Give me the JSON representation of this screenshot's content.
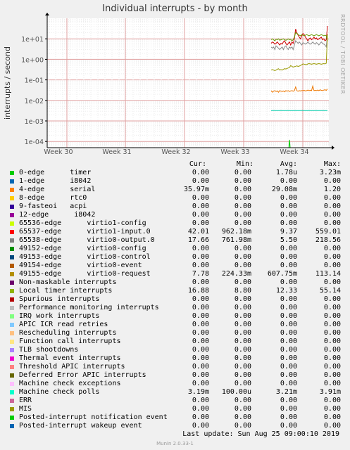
{
  "title": "Individual interrupts - by month",
  "side_label": "RRDTOOL / TOBI OETIKER",
  "footer": {
    "last_update": "Last update:  Sun Aug 25 09:00:10 2019",
    "munin": "Munin 2.0.33-1"
  },
  "chart_data": {
    "type": "line",
    "title": "Individual interrupts - by month",
    "ylabel": "interrupts / second",
    "yscale": "log",
    "ylim": [
      5e-05,
      100
    ],
    "yticks": [
      "1e+01",
      "1e+00",
      "1e-01",
      "1e-02",
      "1e-03",
      "1e-04"
    ],
    "x_ticks": [
      "Week 30",
      "Week 31",
      "Week 32",
      "Week 33",
      "Week 34"
    ],
    "grid": true,
    "series": [
      {
        "name": "virtio1-input.0",
        "color": "#cc0000",
        "x": [
          0.0,
          0.2,
          0.4,
          0.6,
          0.8,
          1.0,
          1.2,
          1.4,
          1.6,
          1.8,
          2.0,
          2.2,
          2.4,
          2.6,
          2.8,
          3.0,
          3.2,
          3.4,
          3.6,
          3.8,
          4.0,
          4.2,
          4.4,
          4.6,
          4.8,
          5.0,
          5.2,
          5.4,
          5.6,
          5.8,
          6.0,
          6.2,
          6.4,
          6.6,
          6.8,
          7.0,
          7.2,
          7.4,
          7.6,
          7.8,
          8.0,
          8.2,
          8.4,
          8.6,
          8.8,
          9.0,
          9.2
        ],
        "y": [
          6.0,
          7.0,
          6.5,
          5.5,
          6.0,
          7.0,
          6.0,
          5.0,
          6.0,
          5.5,
          7.0,
          8.0,
          6.0,
          5.0,
          6.0,
          7.0,
          5.0,
          7.0,
          6.0,
          10.0,
          30.0,
          20.0,
          15.0,
          12.0,
          10.0,
          14.0,
          18.0,
          16.0,
          12.0,
          10.0,
          8.0,
          10.0,
          11.0,
          9.0,
          10.0,
          12.0,
          10.0,
          11.0,
          9.0,
          10.0,
          11.0,
          12.0,
          9.0,
          10.0,
          8.0,
          9.0,
          42.0
        ]
      },
      {
        "name": "virtio0-output.0",
        "color": "#888888",
        "x": [
          0.0,
          0.2,
          0.4,
          0.6,
          0.8,
          1.0,
          1.2,
          1.4,
          1.6,
          1.8,
          2.0,
          2.2,
          2.4,
          2.6,
          2.8,
          3.0,
          3.2,
          3.4,
          3.6,
          3.8,
          4.0,
          4.2,
          4.4,
          4.6,
          4.8,
          5.0,
          5.2,
          5.4,
          5.6,
          5.8,
          6.0,
          6.2,
          6.4,
          6.6,
          6.8,
          7.0,
          7.2,
          7.4,
          7.6,
          7.8,
          8.0,
          8.2,
          8.4,
          8.6,
          8.8,
          9.0,
          9.2
        ],
        "y": [
          4.0,
          3.5,
          4.0,
          3.0,
          4.5,
          4.0,
          3.5,
          3.0,
          3.5,
          4.0,
          3.0,
          4.0,
          4.5,
          3.5,
          3.0,
          4.0,
          3.5,
          4.0,
          3.0,
          5.0,
          8.0,
          7.0,
          6.0,
          7.0,
          6.0,
          5.0,
          6.5,
          6.0,
          5.5,
          6.0,
          7.0,
          6.0,
          5.5,
          6.0,
          7.0,
          6.0,
          5.5,
          6.5,
          6.0,
          5.0,
          6.0,
          7.0,
          6.0,
          5.5,
          5.0,
          4.0,
          17.0
        ]
      },
      {
        "name": "virtio0-request",
        "color": "#669900",
        "x": [
          0.0,
          0.2,
          0.4,
          0.6,
          0.8,
          1.0,
          1.2,
          1.4,
          1.6,
          1.8,
          2.0,
          2.2,
          2.4,
          2.6,
          2.8,
          3.0,
          3.2,
          3.4,
          3.6,
          3.8,
          4.0,
          4.2,
          4.4,
          4.6,
          4.8,
          5.0,
          5.2,
          5.4,
          5.6,
          5.8,
          6.0,
          6.2,
          6.4,
          6.6,
          6.8,
          7.0,
          7.2,
          7.4,
          7.6,
          7.8,
          8.0,
          8.2,
          8.4,
          8.6,
          8.8,
          9.0,
          9.2
        ],
        "y": [
          9.0,
          10.0,
          9.0,
          8.0,
          9.5,
          9.0,
          10.0,
          8.5,
          9.0,
          9.5,
          10.0,
          9.0,
          8.5,
          9.0,
          10.0,
          9.0,
          9.5,
          8.0,
          9.0,
          12.0,
          20.0,
          18.0,
          16.0,
          15.0,
          14.0,
          16.0,
          15.0,
          14.0,
          15.0,
          16.0,
          15.0,
          14.0,
          15.0,
          16.0,
          15.0,
          14.0,
          15.0,
          16.0,
          15.0,
          14.0,
          15.0,
          16.0,
          15.0,
          14.0,
          15.0,
          14.0,
          7.8
        ]
      },
      {
        "name": "Local timer interrupts",
        "color": "#999900",
        "x": [
          0.0,
          0.2,
          0.4,
          0.6,
          0.8,
          1.0,
          1.2,
          1.4,
          1.6,
          1.8,
          2.0,
          2.2,
          2.4,
          2.6,
          2.8,
          3.0,
          3.2,
          3.4,
          3.6,
          3.8,
          4.0,
          4.2,
          4.4,
          4.6,
          4.8,
          5.0,
          5.2,
          5.4,
          5.6,
          5.8,
          6.0,
          6.2,
          6.4,
          6.6,
          6.8,
          7.0,
          7.2,
          7.4,
          7.6,
          7.8,
          8.0,
          8.2,
          8.4,
          8.6,
          8.8,
          9.0,
          9.2
        ],
        "y": [
          0.3,
          0.32,
          0.3,
          0.28,
          0.3,
          0.33,
          0.35,
          0.3,
          0.32,
          0.3,
          0.33,
          0.35,
          0.34,
          0.36,
          0.38,
          0.4,
          0.5,
          0.45,
          0.42,
          0.44,
          0.46,
          0.48,
          0.45,
          0.47,
          0.5,
          0.55,
          0.6,
          0.58,
          0.56,
          0.55,
          0.6,
          0.62,
          0.6,
          0.58,
          0.6,
          0.62,
          0.6,
          0.58,
          0.6,
          0.62,
          0.6,
          0.58,
          0.6,
          0.62,
          0.6,
          0.65,
          16.88
        ]
      },
      {
        "name": "serial",
        "color": "#ee7700",
        "x": [
          0.0,
          0.2,
          0.4,
          0.6,
          0.8,
          1.0,
          1.2,
          1.4,
          1.6,
          1.8,
          2.0,
          2.2,
          2.4,
          2.6,
          2.8,
          3.0,
          3.2,
          3.4,
          3.6,
          3.8,
          4.0,
          4.2,
          4.4,
          4.6,
          4.8,
          5.0,
          5.2,
          5.4,
          5.6,
          5.8,
          6.0,
          6.2,
          6.4,
          6.6,
          6.8,
          7.0,
          7.2,
          7.4,
          7.6,
          7.8,
          8.0,
          8.2,
          8.4,
          8.6,
          8.8,
          9.0,
          9.2
        ],
        "y": [
          0.03,
          0.025,
          0.028,
          0.03,
          0.027,
          0.029,
          0.025,
          0.03,
          0.028,
          0.027,
          0.029,
          0.026,
          0.03,
          0.028,
          0.03,
          0.027,
          0.029,
          0.03,
          0.028,
          0.03,
          0.045,
          0.03,
          0.028,
          0.03,
          0.029,
          0.03,
          0.03,
          0.031,
          0.029,
          0.03,
          0.032,
          0.03,
          0.031,
          0.03,
          0.05,
          0.03,
          0.031,
          0.03,
          0.032,
          0.03,
          0.033,
          0.031,
          0.03,
          0.032,
          0.033,
          0.031,
          0.036
        ]
      },
      {
        "name": "Machine check polls",
        "color": "#00ccaa",
        "x": [
          0.0,
          9.2
        ],
        "y": [
          0.0032,
          0.0032
        ]
      },
      {
        "name": "0-edge",
        "color": "#00cc00",
        "x": [
          0.0,
          2.9,
          3.0,
          3.1,
          9.2
        ],
        "y": [
          5e-05,
          5e-05,
          0.00012,
          5e-05,
          5e-05
        ]
      }
    ]
  },
  "legend": {
    "headers": [
      "Cur:",
      "Min:",
      "Avg:",
      "Max:"
    ],
    "rows": [
      {
        "name": "0-edge      timer",
        "color": "#00cc00",
        "cur": "0.00",
        "min": "0.00",
        "avg": "1.78u",
        "max": "3.23m"
      },
      {
        "name": "1-edge      i8042",
        "color": "#0066b3",
        "cur": "0.00",
        "min": "0.00",
        "avg": "0.00",
        "max": "0.00"
      },
      {
        "name": "4-edge      serial",
        "color": "#ff8000",
        "cur": "35.97m",
        "min": "0.00",
        "avg": "29.08m",
        "max": "1.20"
      },
      {
        "name": "8-edge      rtc0",
        "color": "#ffcc00",
        "cur": "0.00",
        "min": "0.00",
        "avg": "0.00",
        "max": "0.00"
      },
      {
        "name": "9-fasteoi   acpi",
        "color": "#330099",
        "cur": "0.00",
        "min": "0.00",
        "avg": "0.00",
        "max": "0.00"
      },
      {
        "name": "12-edge      i8042",
        "color": "#990099",
        "cur": "0.00",
        "min": "0.00",
        "avg": "0.00",
        "max": "0.00"
      },
      {
        "name": "65536-edge      virtio1-config",
        "color": "#ccff00",
        "cur": "0.00",
        "min": "0.00",
        "avg": "0.00",
        "max": "0.00"
      },
      {
        "name": "65537-edge      virtio1-input.0",
        "color": "#ff0000",
        "cur": "42.01",
        "min": "962.18m",
        "avg": "9.37",
        "max": "559.01"
      },
      {
        "name": "65538-edge      virtio0-output.0",
        "color": "#808080",
        "cur": "17.66",
        "min": "761.98m",
        "avg": "5.50",
        "max": "218.56"
      },
      {
        "name": "49152-edge      virtio0-config",
        "color": "#008f00",
        "cur": "0.00",
        "min": "0.00",
        "avg": "0.00",
        "max": "0.00"
      },
      {
        "name": "49153-edge      virtio0-control",
        "color": "#00487d",
        "cur": "0.00",
        "min": "0.00",
        "avg": "0.00",
        "max": "0.00"
      },
      {
        "name": "49154-edge      virtio0-event",
        "color": "#b35a00",
        "cur": "0.00",
        "min": "0.00",
        "avg": "0.00",
        "max": "0.00"
      },
      {
        "name": "49155-edge      virtio0-request",
        "color": "#b38f00",
        "cur": "7.78",
        "min": "224.33m",
        "avg": "607.75m",
        "max": "113.14"
      },
      {
        "name": "Non-maskable interrupts",
        "color": "#6b006b",
        "cur": "0.00",
        "min": "0.00",
        "avg": "0.00",
        "max": "0.00"
      },
      {
        "name": "Local timer interrupts",
        "color": "#8fb300",
        "cur": "16.88",
        "min": "8.80",
        "avg": "12.33",
        "max": "55.14"
      },
      {
        "name": "Spurious interrupts",
        "color": "#b30000",
        "cur": "0.00",
        "min": "0.00",
        "avg": "0.00",
        "max": "0.00"
      },
      {
        "name": "Performance monitoring interrupts",
        "color": "#bebebe",
        "cur": "0.00",
        "min": "0.00",
        "avg": "0.00",
        "max": "0.00"
      },
      {
        "name": "IRQ work interrupts",
        "color": "#80ff80",
        "cur": "0.00",
        "min": "0.00",
        "avg": "0.00",
        "max": "0.00"
      },
      {
        "name": "APIC ICR read retries",
        "color": "#80c9ff",
        "cur": "0.00",
        "min": "0.00",
        "avg": "0.00",
        "max": "0.00"
      },
      {
        "name": "Rescheduling interrupts",
        "color": "#ffc080",
        "cur": "0.00",
        "min": "0.00",
        "avg": "0.00",
        "max": "0.00"
      },
      {
        "name": "Function call interrupts",
        "color": "#ffe680",
        "cur": "0.00",
        "min": "0.00",
        "avg": "0.00",
        "max": "0.00"
      },
      {
        "name": "TLB shootdowns",
        "color": "#aa80ff",
        "cur": "0.00",
        "min": "0.00",
        "avg": "0.00",
        "max": "0.00"
      },
      {
        "name": "Thermal event interrupts",
        "color": "#ee00cc",
        "cur": "0.00",
        "min": "0.00",
        "avg": "0.00",
        "max": "0.00"
      },
      {
        "name": "Threshold APIC interrupts",
        "color": "#ff8080",
        "cur": "0.00",
        "min": "0.00",
        "avg": "0.00",
        "max": "0.00"
      },
      {
        "name": "Deferred Error APIC interrupts",
        "color": "#666600",
        "cur": "0.00",
        "min": "0.00",
        "avg": "0.00",
        "max": "0.00"
      },
      {
        "name": "Machine check exceptions",
        "color": "#ffbfff",
        "cur": "0.00",
        "min": "0.00",
        "avg": "0.00",
        "max": "0.00"
      },
      {
        "name": "Machine check polls",
        "color": "#00ffcc",
        "cur": "3.19m",
        "min": "100.00u",
        "avg": "3.21m",
        "max": "3.91m"
      },
      {
        "name": "ERR",
        "color": "#cc6699",
        "cur": "0.00",
        "min": "0.00",
        "avg": "0.00",
        "max": "0.00"
      },
      {
        "name": "MIS",
        "color": "#999900",
        "cur": "0.00",
        "min": "0.00",
        "avg": "0.00",
        "max": "0.00"
      },
      {
        "name": "Posted-interrupt notification event",
        "color": "#00cc00",
        "cur": "0.00",
        "min": "0.00",
        "avg": "0.00",
        "max": "0.00"
      },
      {
        "name": "Posted-interrupt wakeup event",
        "color": "#0066b3",
        "cur": "0.00",
        "min": "0.00",
        "avg": "0.00",
        "max": "0.00"
      }
    ]
  }
}
